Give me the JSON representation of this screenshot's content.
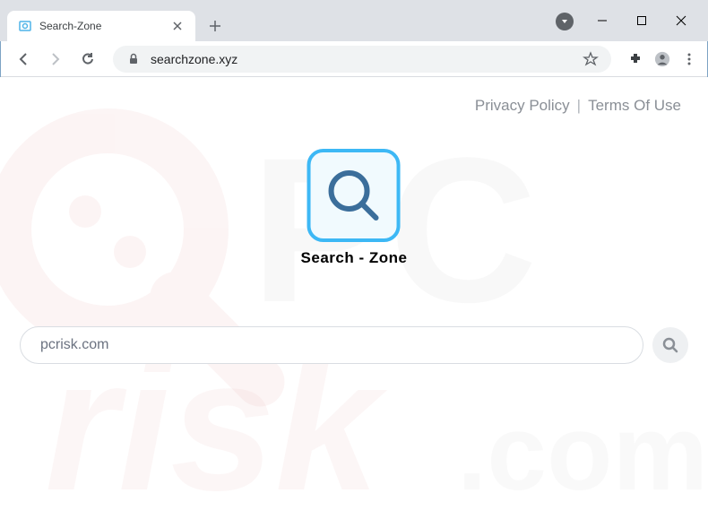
{
  "window": {
    "tab_title": "Search-Zone"
  },
  "toolbar": {
    "url": "searchzone.xyz"
  },
  "page": {
    "links": {
      "privacy": "Privacy Policy",
      "divider": "|",
      "terms": "Terms Of Use"
    },
    "logo_title": "Search - Zone",
    "search_value": "pcrisk.com"
  }
}
